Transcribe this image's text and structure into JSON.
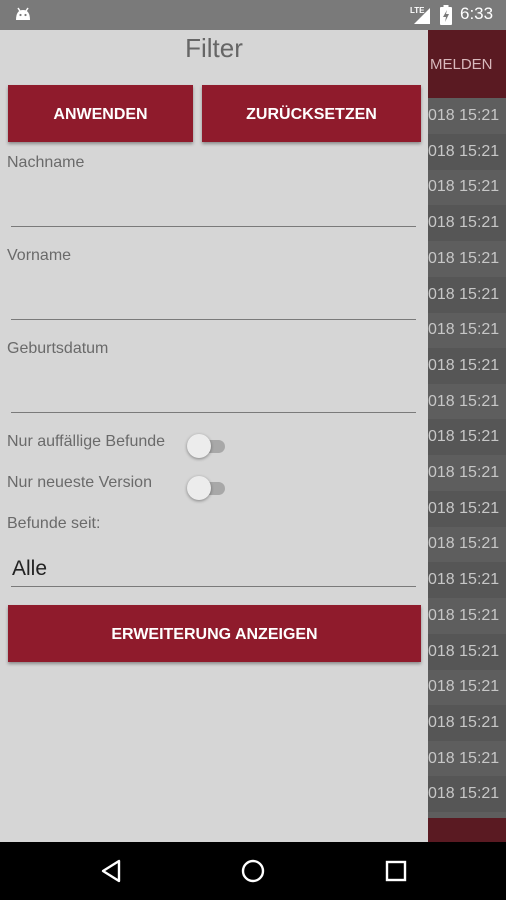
{
  "status_bar": {
    "time": "6:33",
    "network": "LTE"
  },
  "background_app": {
    "toolbar_label": "MELDEN",
    "rows": [
      "018 15:21",
      "018 15:21",
      "018 15:21",
      "018 15:21",
      "018 15:21",
      "018 15:21",
      "018 15:21",
      "018 15:21",
      "018 15:21",
      "018 15:21",
      "018 15:21",
      "018 15:21",
      "018 15:21",
      "018 15:21",
      "018 15:21",
      "018 15:21",
      "018 15:21",
      "018 15:21",
      "018 15:21",
      "018 15:21"
    ]
  },
  "filter": {
    "title": "Filter",
    "apply_label": "ANWENDEN",
    "reset_label": "ZURÜCKSETZEN",
    "lastname_label": "Nachname",
    "lastname_value": "",
    "firstname_label": "Vorname",
    "firstname_value": "",
    "birthdate_label": "Geburtsdatum",
    "birthdate_value": "",
    "abnormal_label": "Nur auffällige Befunde",
    "abnormal_on": false,
    "newest_label": "Nur neueste Version",
    "newest_on": false,
    "since_label": "Befunde seit:",
    "since_value": "Alle",
    "extension_label": "ERWEITERUNG ANZEIGEN"
  },
  "colors": {
    "accent": "#8f1b2c",
    "drawer_bg": "#d6d6d6",
    "status_bar": "#7a7a7a"
  }
}
